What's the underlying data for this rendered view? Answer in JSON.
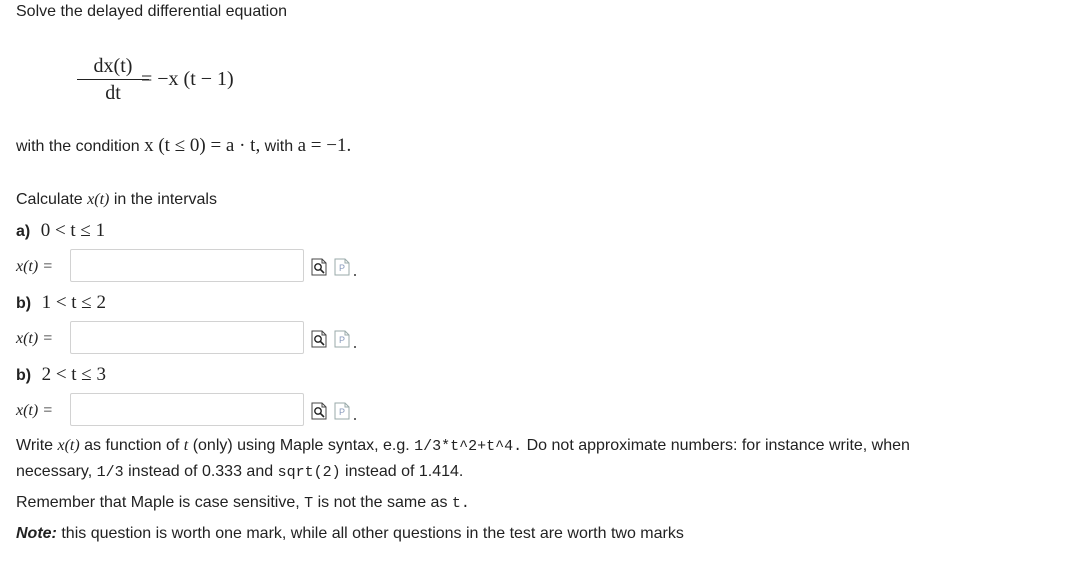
{
  "heading": "Solve the delayed differential equation",
  "equation": {
    "numerator": "dx(t)",
    "denominator": "dt",
    "rhs": "= −x (t − 1)"
  },
  "condition": {
    "prefix": "with the condition",
    "math": "x (t ≤ 0) = a · t,",
    "with": "with",
    "a_value": "a = −1."
  },
  "calculate": {
    "prefix": "Calculate",
    "var": "x(t)",
    "suffix": "in the intervals"
  },
  "parts": [
    {
      "label": "a)",
      "interval": "0 < t ≤ 1",
      "input_label": "x(t) =",
      "value": ""
    },
    {
      "label": "b)",
      "interval": "1 <  t ≤ 2",
      "input_label": "x(t) =",
      "value": ""
    },
    {
      "label": "b)",
      "interval": "2 <  t ≤ 3",
      "input_label": "x(t) =",
      "value": ""
    }
  ],
  "instructions": {
    "line1_a": "Write",
    "line1_var": "x(t)",
    "line1_b": "as function of",
    "line1_t": "t",
    "line1_c": "(only) using Maple syntax, e.g.",
    "example": "1/3*t^2+t^4.",
    "line1_d": "Do not approximate numbers: for instance write, when",
    "line2_a": "necessary,",
    "frac_code": "1/3",
    "line2_b": "instead of 0.333 and",
    "sqrt_code": "sqrt(2)",
    "line2_c": "instead of 1.414."
  },
  "remember": {
    "a": "Remember that Maple is case sensitive,",
    "upper_t": "T",
    "b": "is not the same as",
    "lower_t": "t."
  },
  "note": {
    "label": "Note:",
    "text": "this question is worth one mark, while all other questions in the test are worth two marks"
  }
}
